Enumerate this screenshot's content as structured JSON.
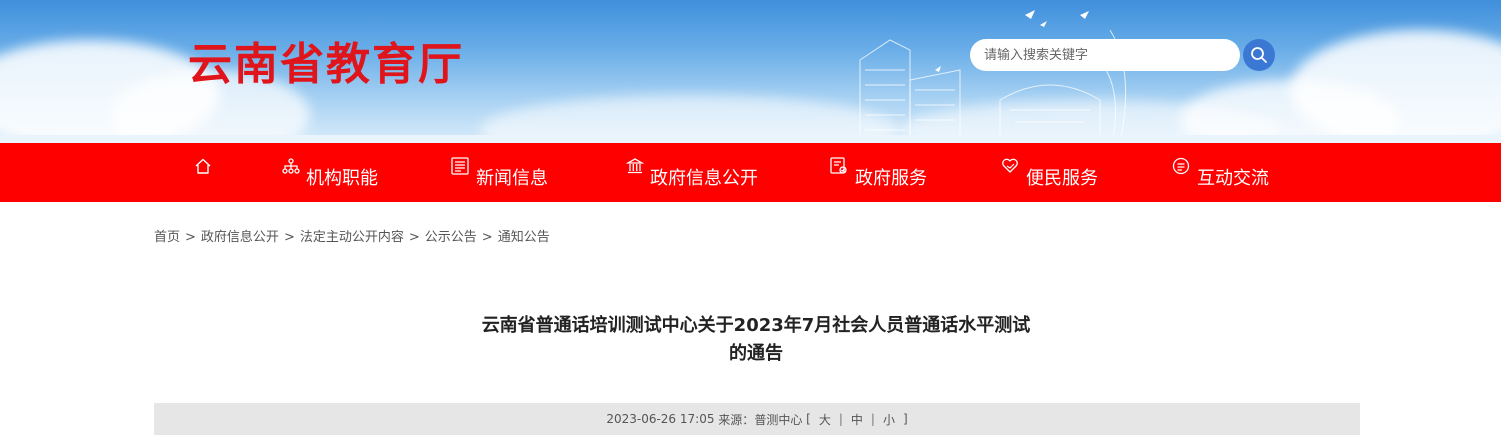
{
  "header": {
    "site_title": "云南省教育厅",
    "search": {
      "placeholder": "请输入搜索关键字",
      "button_icon": "search-icon"
    },
    "brand_color": "#e0151b"
  },
  "nav": {
    "background": "#fe0000",
    "items": [
      {
        "label": "",
        "icon": "home-icon"
      },
      {
        "label": "机构职能",
        "icon": "org-chart-icon"
      },
      {
        "label": "新闻信息",
        "icon": "news-icon"
      },
      {
        "label": "政府信息公开",
        "icon": "government-building-icon"
      },
      {
        "label": "政府服务",
        "icon": "service-document-icon"
      },
      {
        "label": "便民服务",
        "icon": "heart-hand-icon"
      },
      {
        "label": "互动交流",
        "icon": "chat-icon"
      }
    ]
  },
  "breadcrumb": {
    "separator": ">",
    "items": [
      "首页",
      "政府信息公开",
      "法定主动公开内容",
      "公示公告",
      "通知公告"
    ]
  },
  "article": {
    "title_line1": "云南省普通话培训测试中心关于2023年7月社会人员普通话水平测试",
    "title_line2": "的通告",
    "meta": {
      "datetime": "2023-06-26 17:05",
      "source_label": "来源：",
      "source": "普测中心",
      "bracket_open": "[",
      "bracket_close": "]",
      "size_large": "大",
      "size_medium": "中",
      "size_small": "小",
      "pipe": "|"
    }
  }
}
